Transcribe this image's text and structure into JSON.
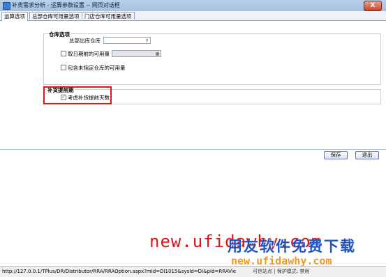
{
  "window": {
    "title": "补货需求分析 - 运算参数设置 -- 网页对话框",
    "close_label": "X"
  },
  "tabs": [
    "运算选项",
    "总部仓库可用量选项",
    "门店仓库可用量选项"
  ],
  "warehouse_group": {
    "legend": "仓库选项",
    "hq_warehouse_label": "总部出库仓库",
    "hq_warehouse_value": "",
    "option_prev_day": "取日期前的可用量",
    "option_prev_day_value": "",
    "option_unassigned": "包含未指定仓库的可用量"
  },
  "lead_group": {
    "legend": "补货提前期",
    "option_lead_days": "考虑补货提前天数",
    "option_lead_days_checked": true
  },
  "buttons": {
    "save": "保存",
    "exit": "退出"
  },
  "watermark": {
    "url_red": "new.ufidawhy.com",
    "slogan": "用友软件免费下载",
    "url_orange": "new.ufidawhy.com"
  },
  "statusbar": {
    "url": "http://127.0.0.1/TPlus/DR/Distributor/RRA/RRAOption.aspx?mId=DI1015&sysId=DI&pId=RRAVie",
    "right": "可信站点 | 保护模式: 禁用"
  }
}
